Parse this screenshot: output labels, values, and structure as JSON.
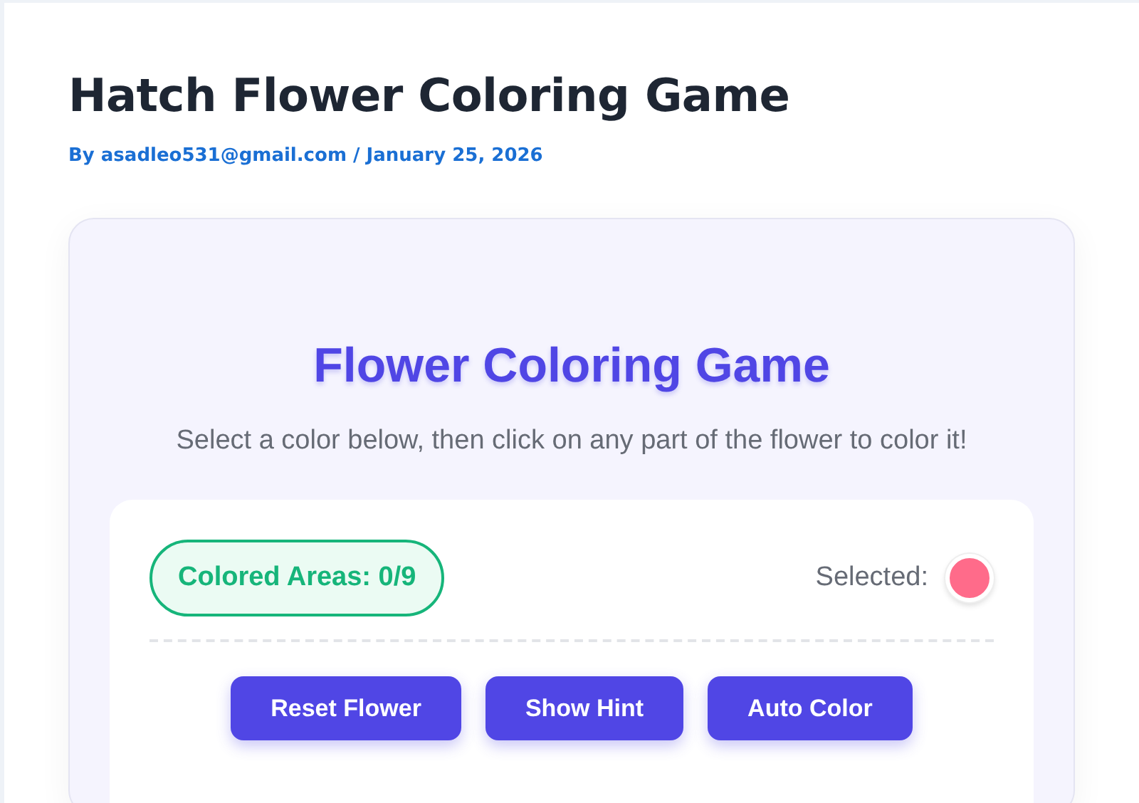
{
  "post": {
    "title": "Hatch Flower Coloring Game",
    "meta": "By asadleo531@gmail.com / January 25, 2026"
  },
  "game": {
    "title": "Flower Coloring Game",
    "subtitle": "Select a color below, then click on any part of the flower to color it!",
    "progress": "Colored Areas: 0/9",
    "selected": {
      "label": "Selected:",
      "color": "#ff6b8a"
    },
    "buttons": [
      "Reset Flower",
      "Show Hint",
      "Auto Color"
    ]
  }
}
